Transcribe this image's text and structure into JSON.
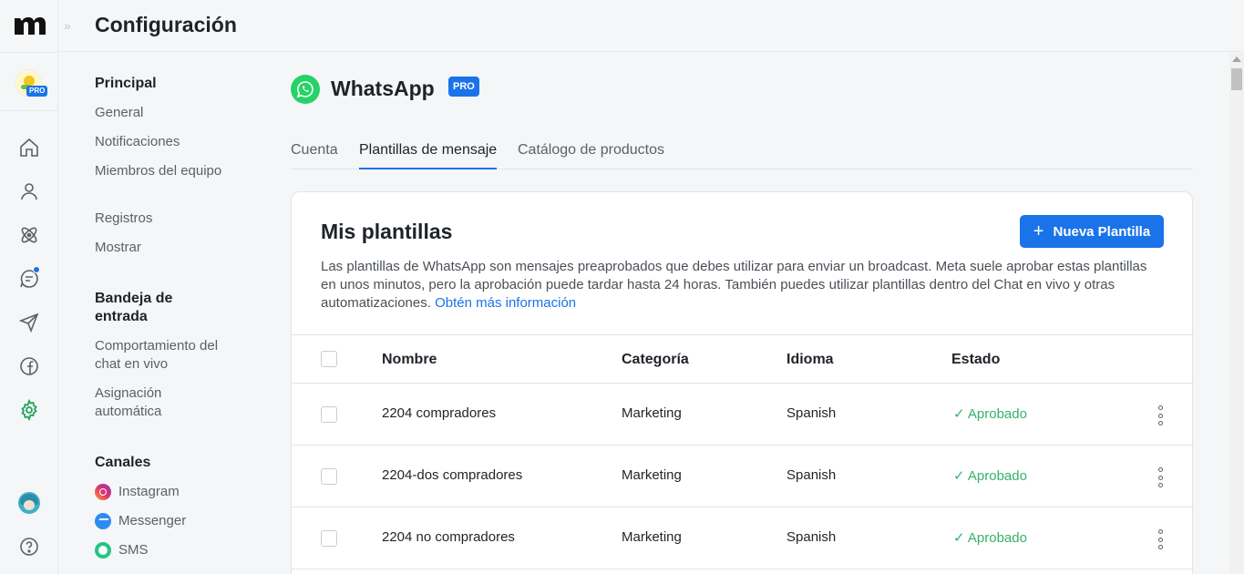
{
  "header": {
    "title": "Configuración"
  },
  "sidebar": {
    "sections": [
      {
        "title": "Principal",
        "items": [
          "General",
          "Notificaciones",
          "Miembros del equipo",
          "Registros",
          "Mostrar"
        ]
      },
      {
        "title": "Bandeja de entrada",
        "items": [
          "Comportamiento del chat en vivo",
          "Asignación automática"
        ]
      },
      {
        "title": "Canales",
        "items": [
          "Instagram",
          "Messenger",
          "SMS"
        ]
      }
    ]
  },
  "workspace": {
    "badge": "PRO"
  },
  "page": {
    "title": "WhatsApp",
    "badge": "PRO"
  },
  "tabs": [
    "Cuenta",
    "Plantillas de mensaje",
    "Catálogo de productos"
  ],
  "card": {
    "title": "Mis plantillas",
    "new_button": "Nueva Plantilla",
    "description": "Las plantillas de WhatsApp son mensajes preaprobados que debes utilizar para enviar un broadcast. Meta suele aprobar estas plantillas en unos minutos, pero la aprobación puede tardar hasta 24 horas. También puedes utilizar plantillas dentro del Chat en vivo y otras automatizaciones.",
    "link": "Obtén más información"
  },
  "table": {
    "columns": [
      "Nombre",
      "Categoría",
      "Idioma",
      "Estado"
    ],
    "rows": [
      {
        "name": "2204 compradores",
        "category": "Marketing",
        "language": "Spanish",
        "status": "✓ Aprobado"
      },
      {
        "name": "2204-dos compradores",
        "category": "Marketing",
        "language": "Spanish",
        "status": "✓ Aprobado"
      },
      {
        "name": "2204 no compradores",
        "category": "Marketing",
        "language": "Spanish",
        "status": "✓ Aprobado"
      }
    ]
  },
  "colors": {
    "accent": "#1a73e8",
    "success": "#34b16b",
    "whatsapp": "#25d366"
  }
}
